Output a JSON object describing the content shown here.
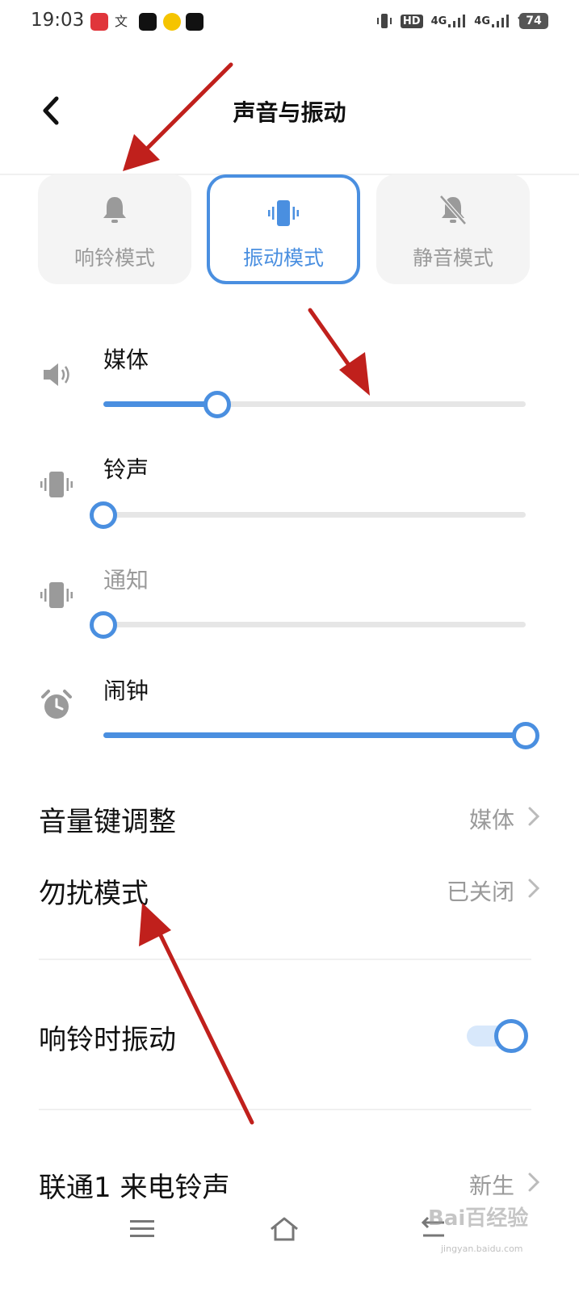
{
  "status_bar": {
    "time": "19:03",
    "signal_labels": [
      "HD",
      "4G",
      "4G"
    ],
    "battery": "74"
  },
  "header": {
    "title": "声音与振动"
  },
  "modes": [
    {
      "label": "响铃模式",
      "icon": "bell-icon",
      "selected": false
    },
    {
      "label": "振动模式",
      "icon": "vibrate-icon",
      "selected": true
    },
    {
      "label": "静音模式",
      "icon": "bell-off-icon",
      "selected": false
    }
  ],
  "volumes": [
    {
      "label": "媒体",
      "icon": "speaker-icon",
      "level": 0.27
    },
    {
      "label": "铃声",
      "icon": "vibrate-icon",
      "level": 0.0
    },
    {
      "label": "通知",
      "icon": "vibrate-icon",
      "level": 0.0
    },
    {
      "label": "闹钟",
      "icon": "alarm-clock-icon",
      "level": 1.0
    }
  ],
  "settings": {
    "volume_key": {
      "label": "音量键调整",
      "value": "媒体"
    },
    "dnd": {
      "label": "勿扰模式",
      "value": "已关闭"
    },
    "vibrate_on_ring": {
      "label": "响铃时振动",
      "on": true
    },
    "ringtone": {
      "label": "联通1 来电铃声",
      "value": "新生"
    }
  },
  "watermark": {
    "main": "Bai百经验",
    "sub": "jingyan.baidu.com"
  },
  "colors": {
    "accent": "#4a8fe0",
    "arrow": "#c0201c",
    "muted": "#9a9a9a"
  }
}
